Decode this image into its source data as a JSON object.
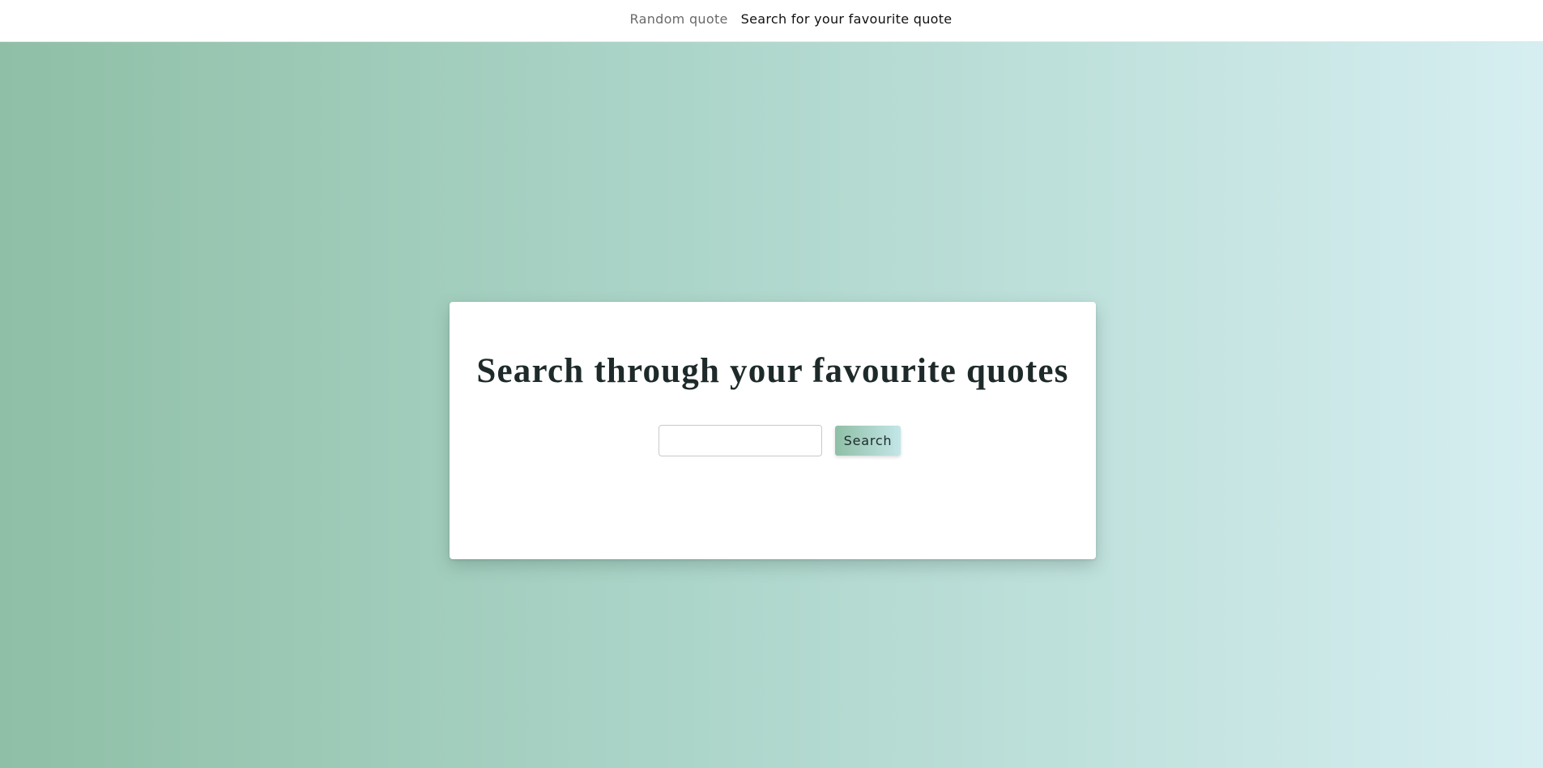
{
  "nav": {
    "links": [
      {
        "label": "Random quote",
        "active": false
      },
      {
        "label": "Search for your favourite quote",
        "active": true
      }
    ]
  },
  "card": {
    "title": "Search through your favourite quotes",
    "search_input": {
      "value": "",
      "placeholder": ""
    },
    "search_button_label": "Search"
  },
  "colors": {
    "gradient_start": "#8fbfa6",
    "gradient_end": "#d6eef1",
    "nav_active": "#111111",
    "nav_inactive": "#6a6a6a"
  }
}
